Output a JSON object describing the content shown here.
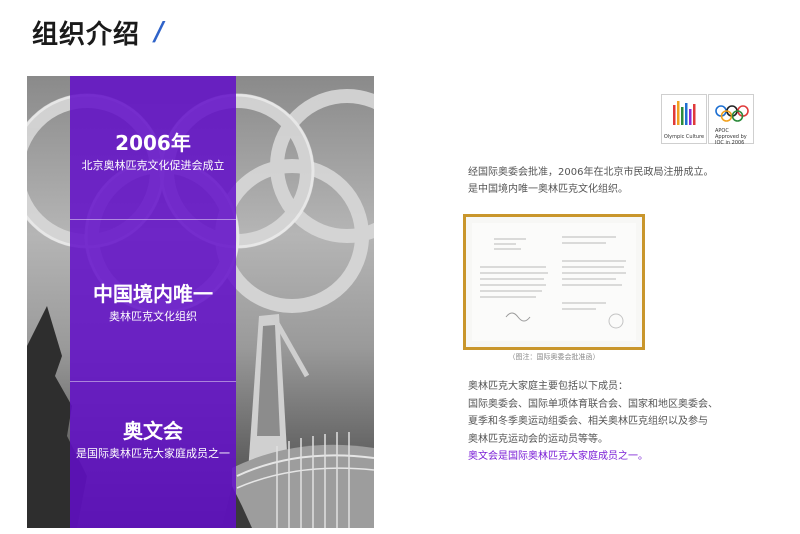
{
  "header": {
    "title": "组织介绍",
    "slash": "/"
  },
  "left": {
    "blocks": [
      {
        "title": "2006年",
        "subtitle": "北京奥林匹克文化促进会成立"
      },
      {
        "title": "中国境内唯一",
        "subtitle": "奥林匹克文化组织"
      },
      {
        "title": "奥文会",
        "subtitle": "是国际奥林匹克大家庭成员之一"
      }
    ]
  },
  "right": {
    "logos": [
      {
        "name": "olympic-culture-logo",
        "caption": "Olympic Culture"
      },
      {
        "name": "apoc-logo",
        "caption": "APOC Approved by IOC in 2006"
      }
    ],
    "intro_lines": [
      "经国际奥委会批准，2006年在北京市民政局注册成立。",
      "是中国境内唯一奥林匹克文化组织。"
    ],
    "certificate_caption": "（图注：国际奥委会批准函）",
    "members_lines": [
      "奥林匹克大家庭主要包括以下成员：",
      "国际奥委会、国际单项体育联合会、国家和地区奥委会、",
      "夏季和冬季奥运动组委会、相关奥林匹克组织以及参与",
      "奥林匹克运动会的运动员等等。"
    ],
    "highlight_line": "奥文会是国际奥林匹克大家庭成员之一。"
  },
  "colors": {
    "accent_purple": "#620ec8",
    "highlight_purple": "#7b1fd6",
    "slash_blue": "#2f63c9",
    "certificate_border": "#c9962c"
  }
}
